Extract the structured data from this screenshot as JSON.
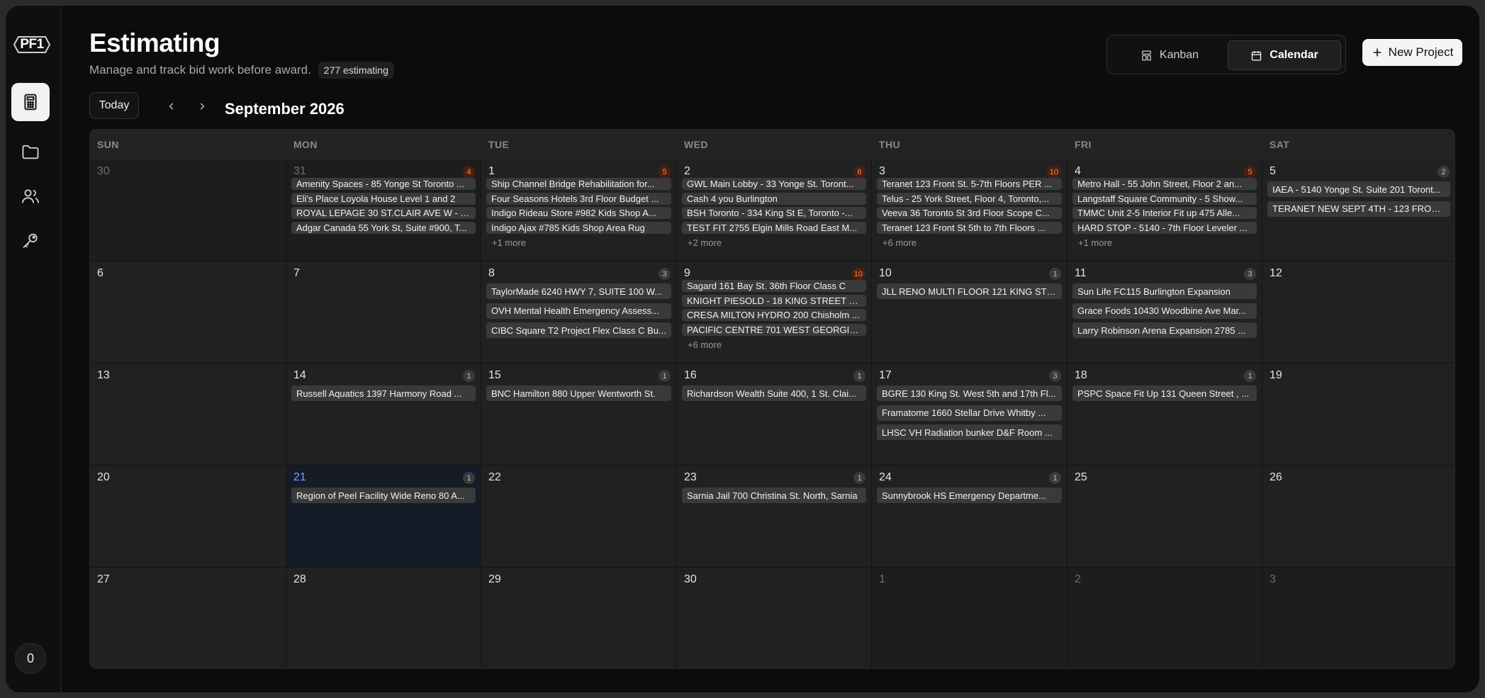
{
  "app": {
    "logo_text": "PF1",
    "user_count": "0"
  },
  "sidebar": {
    "items": [
      {
        "name": "estimating",
        "icon": "calculator-icon",
        "active": true
      },
      {
        "name": "projects",
        "icon": "folder-icon",
        "active": false
      },
      {
        "name": "users",
        "icon": "users-icon",
        "active": false
      },
      {
        "name": "keys",
        "icon": "key-icon",
        "active": false
      }
    ]
  },
  "header": {
    "title": "Estimating",
    "subtitle": "Manage and track bid work before award.",
    "count_label": "277 estimating"
  },
  "view_toggle": {
    "kanban_label": "Kanban",
    "calendar_label": "Calendar",
    "active": "Calendar"
  },
  "new_project_label": "New Project",
  "toolbar": {
    "today_label": "Today",
    "month_label": "September 2026"
  },
  "calendar": {
    "weekdays": [
      "SUN",
      "MON",
      "TUE",
      "WED",
      "THU",
      "FRI",
      "SAT"
    ],
    "weeks": [
      [
        {
          "day": "30",
          "outside": true,
          "count": "",
          "events": [],
          "more": ""
        },
        {
          "day": "31",
          "outside": true,
          "count": "4",
          "hot": true,
          "events": [
            "Amenity Spaces - 85 Yonge St Toronto ...",
            "Eli's Place Loyola House Level 1 and 2",
            "ROYAL LEPAGE 30 ST.CLAIR AVE W - 11...",
            "Adgar Canada 55 York St, Suite #900, T..."
          ],
          "more": ""
        },
        {
          "day": "1",
          "count": "5",
          "hot": true,
          "events": [
            "Ship Channel Bridge Rehabilitation for...",
            "Four Seasons Hotels 3rd Floor Budget ...",
            "Indigo Rideau Store #982 Kids Shop A...",
            "Indigo Ajax #785 Kids Shop Area Rug"
          ],
          "more": "+1 more"
        },
        {
          "day": "2",
          "count": "6",
          "hot": true,
          "events": [
            "GWL Main Lobby - 33 Yonge St. Toront...",
            "Cash 4 you Burlington",
            "BSH Toronto - 334 King St E, Toronto -...",
            "TEST FIT 2755 Elgin Mills Road East M..."
          ],
          "more": "+2 more"
        },
        {
          "day": "3",
          "count": "10",
          "hot": true,
          "events": [
            "Teranet 123 Front St. 5-7th Floors PER ...",
            "Telus - 25 York Street, Floor 4, Toronto,...",
            "Veeva 36 Toronto St 3rd Floor Scope C...",
            "Teranet 123 Front St 5th to 7th Floors ..."
          ],
          "more": "+6 more"
        },
        {
          "day": "4",
          "count": "5",
          "hot": true,
          "events": [
            "Metro Hall - 55 John Street, Floor 2 an...",
            "Langstaff Square Community - 5 Show...",
            "TMMC Unit 2-5 Interior Fit up 475 Alle...",
            "HARD STOP - 5140 - 7th Floor Leveler ..."
          ],
          "more": "+1 more"
        },
        {
          "day": "5",
          "count": "2",
          "events": [
            "IAEA - 5140 Yonge St. Suite 201 Toront...",
            "TERANET NEW SEPT 4TH - 123 FRONT ..."
          ],
          "more": ""
        }
      ],
      [
        {
          "day": "6",
          "count": "",
          "events": [],
          "more": ""
        },
        {
          "day": "7",
          "count": "",
          "events": [],
          "more": ""
        },
        {
          "day": "8",
          "count": "3",
          "events": [
            "TaylorMade 6240 HWY 7, SUITE 100 W...",
            "OVH Mental Health Emergency Assess...",
            "CIBC Square T2 Project Flex Class C Bu..."
          ],
          "more": ""
        },
        {
          "day": "9",
          "count": "10",
          "hot": true,
          "events": [
            "Sagard 161 Bay St. 36th Floor Class C",
            "KNIGHT PIESOLD - 18 KING STREET E -...",
            "CRESA MILTON HYDRO 200 Chisholm ...",
            "PACIFIC CENTRE 701 WEST GEORGIA S..."
          ],
          "more": "+6 more"
        },
        {
          "day": "10",
          "count": "1",
          "events": [
            "JLL RENO MULTI FLOOR 121 KING STR..."
          ],
          "more": ""
        },
        {
          "day": "11",
          "count": "3",
          "events": [
            "Sun Life FC115 Burlington Expansion",
            "Grace Foods 10430 Woodbine Ave Mar...",
            "Larry Robinson Arena Expansion 2785 ..."
          ],
          "more": ""
        },
        {
          "day": "12",
          "count": "",
          "events": [],
          "more": ""
        }
      ],
      [
        {
          "day": "13",
          "count": "",
          "events": [],
          "more": ""
        },
        {
          "day": "14",
          "count": "1",
          "events": [
            "Russell Aquatics 1397 Harmony Road ..."
          ],
          "more": ""
        },
        {
          "day": "15",
          "count": "1",
          "events": [
            "BNC Hamilton 880 Upper Wentworth St."
          ],
          "more": ""
        },
        {
          "day": "16",
          "count": "1",
          "events": [
            "Richardson Wealth Suite 400, 1 St. Clai..."
          ],
          "more": ""
        },
        {
          "day": "17",
          "count": "3",
          "events": [
            "BGRE 130 King St. West 5th and 17th Fl...",
            "Framatome 1660 Stellar Drive Whitby ...",
            "LHSC VH Radiation bunker D&F Room ..."
          ],
          "more": ""
        },
        {
          "day": "18",
          "count": "1",
          "events": [
            "PSPC Space Fit Up 131 Queen Street , ..."
          ],
          "more": ""
        },
        {
          "day": "19",
          "count": "",
          "events": [],
          "more": ""
        }
      ],
      [
        {
          "day": "20",
          "count": "",
          "events": [],
          "more": ""
        },
        {
          "day": "21",
          "today": true,
          "count": "1",
          "events": [
            "Region of Peel Facility Wide Reno 80 A..."
          ],
          "more": ""
        },
        {
          "day": "22",
          "count": "",
          "events": [],
          "more": ""
        },
        {
          "day": "23",
          "count": "1",
          "events": [
            "Sarnia Jail 700 Christina St. North, Sarnia"
          ],
          "more": ""
        },
        {
          "day": "24",
          "count": "1",
          "events": [
            "Sunnybrook HS Emergency Departme..."
          ],
          "more": ""
        },
        {
          "day": "25",
          "count": "",
          "events": [],
          "more": ""
        },
        {
          "day": "26",
          "count": "",
          "events": [],
          "more": ""
        }
      ],
      [
        {
          "day": "27",
          "count": "",
          "events": [],
          "more": ""
        },
        {
          "day": "28",
          "count": "",
          "events": [],
          "more": ""
        },
        {
          "day": "29",
          "count": "",
          "events": [],
          "more": ""
        },
        {
          "day": "30",
          "count": "",
          "events": [],
          "more": ""
        },
        {
          "day": "1",
          "outside": true,
          "count": "",
          "events": [],
          "more": ""
        },
        {
          "day": "2",
          "outside": true,
          "count": "",
          "events": [],
          "more": ""
        },
        {
          "day": "3",
          "outside": true,
          "count": "",
          "events": [],
          "more": ""
        }
      ]
    ]
  }
}
